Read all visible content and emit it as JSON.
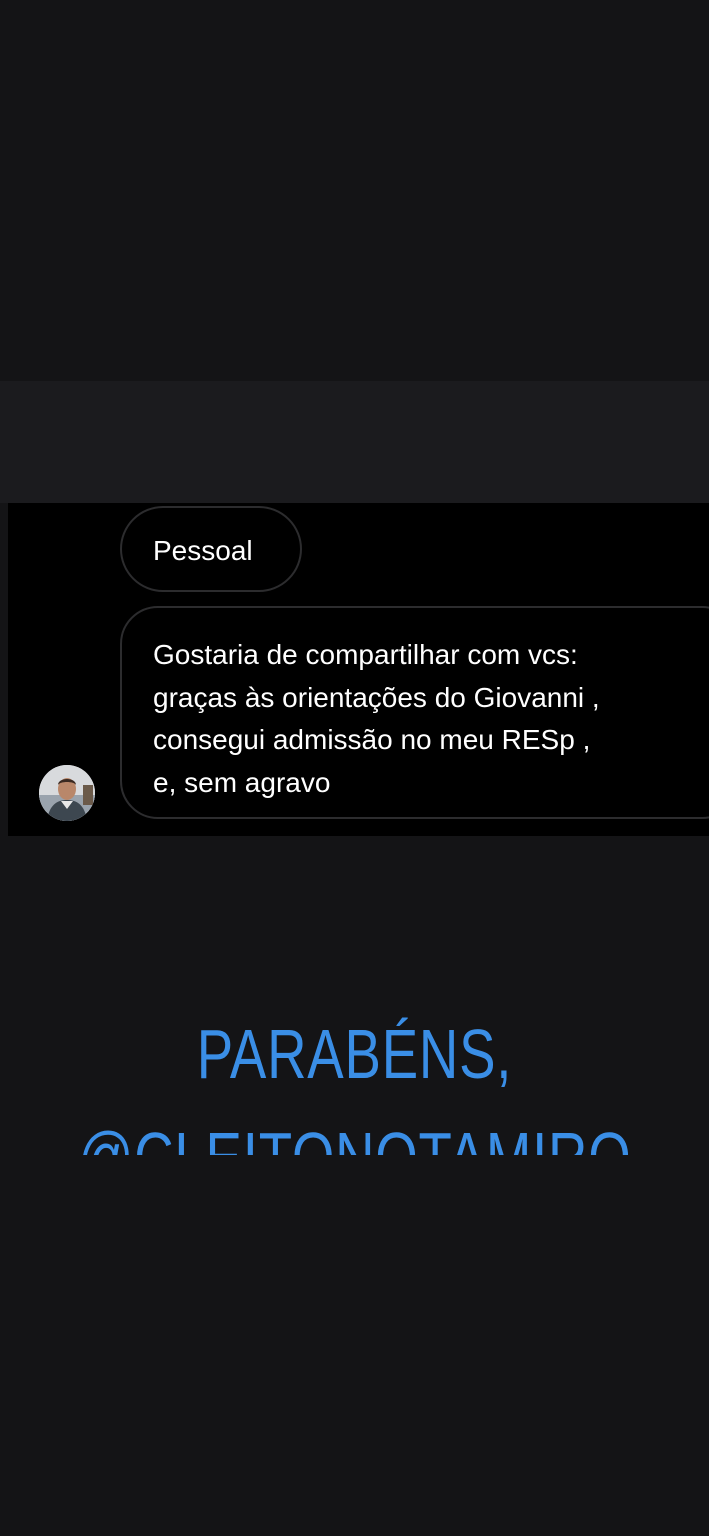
{
  "chat": {
    "messages": [
      {
        "lines": [
          "Pessoal"
        ]
      },
      {
        "lines": [
          "Gostaria de compartilhar com vcs:",
          "graças às orientações do Giovanni ,",
          "consegui admissão no meu RESp ,",
          "e, sem agravo"
        ]
      }
    ],
    "avatar_icon": "person-photo"
  },
  "overlay": {
    "line1": "PARABÉNS,",
    "line2": "@CLEITONOTAMIRO"
  },
  "colors": {
    "background": "#141416",
    "band": "#1b1b1e",
    "accent": "#3a8ee6",
    "bubble_border": "#2c2c2e"
  }
}
